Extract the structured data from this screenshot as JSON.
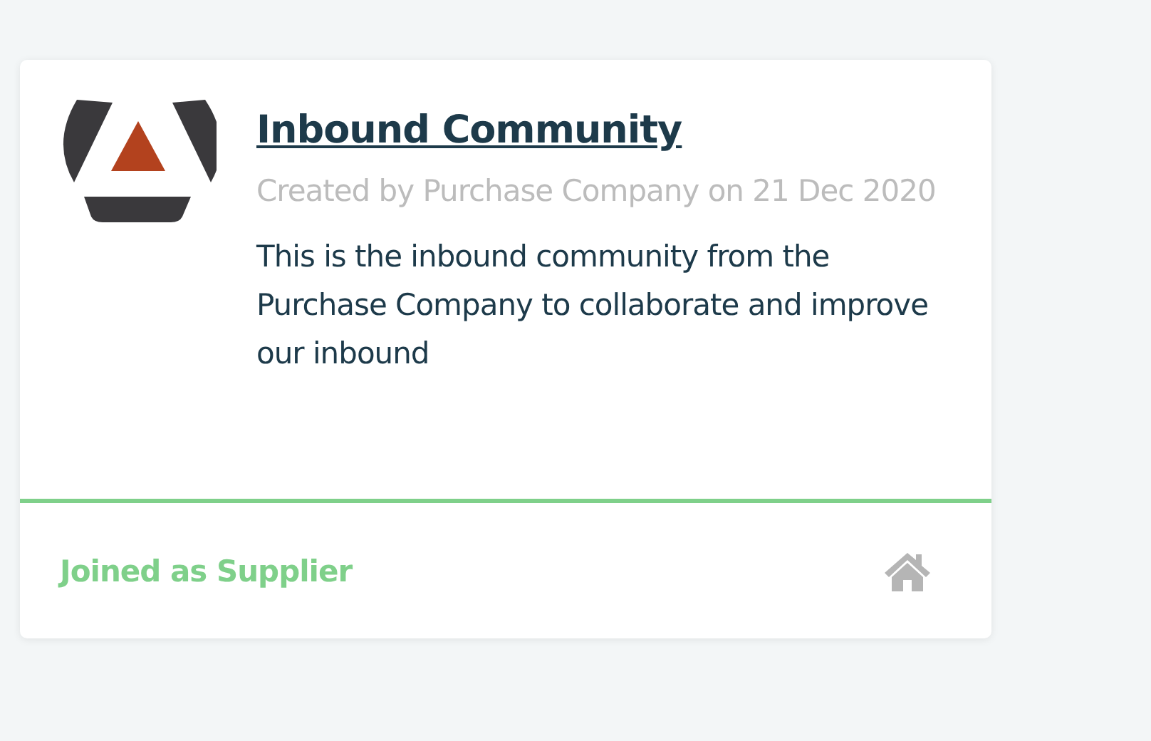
{
  "community": {
    "title": "Inbound Community",
    "meta": "Created by Purchase Company on 21 Dec 2020",
    "description": "This is the inbound community from the Purchase Company to collaborate and improve our inbound"
  },
  "footer": {
    "status": "Joined as Supplier"
  }
}
